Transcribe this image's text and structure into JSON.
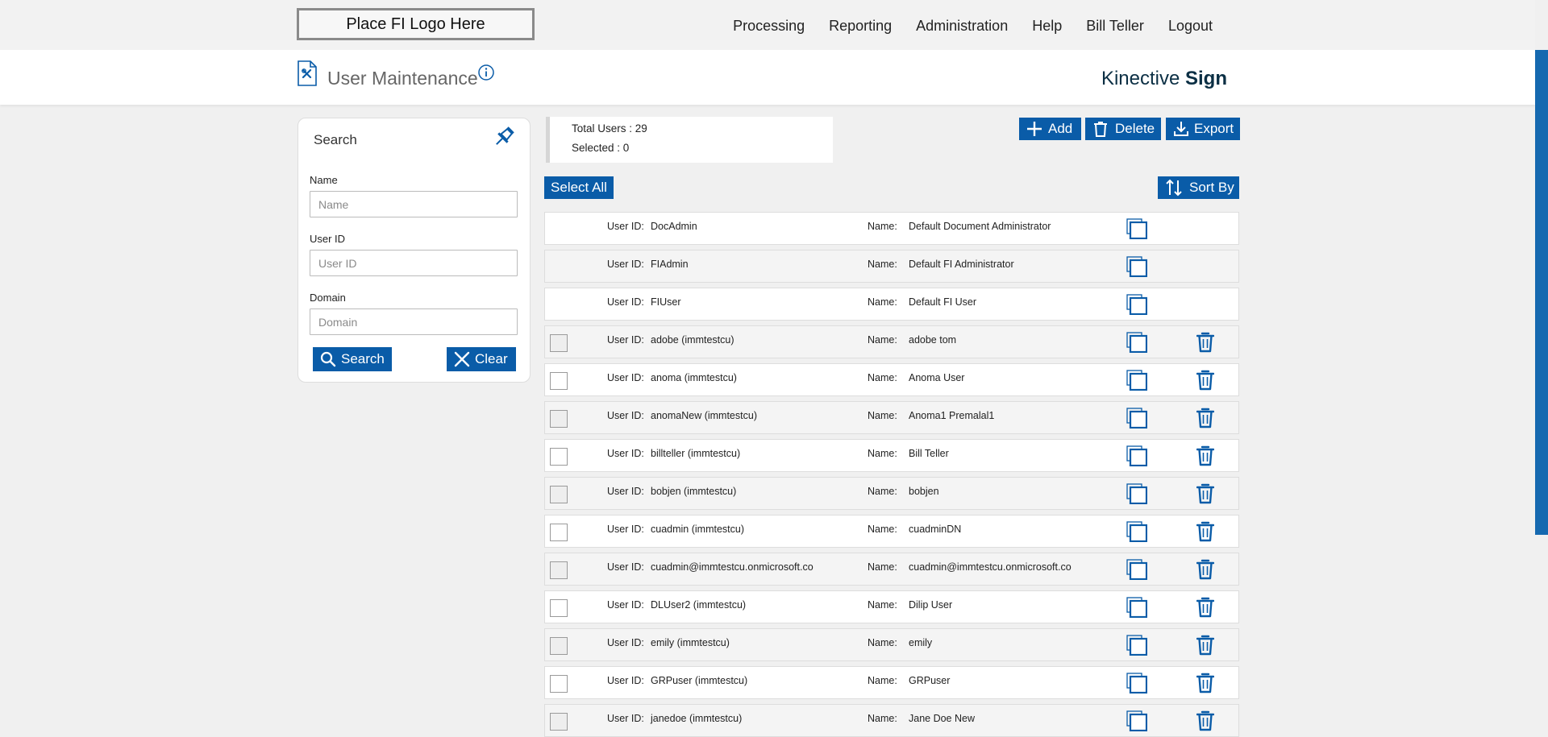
{
  "logo": {
    "text": "Place FI Logo Here"
  },
  "nav": [
    {
      "label": "Processing"
    },
    {
      "label": "Reporting"
    },
    {
      "label": "Administration"
    },
    {
      "label": "Help"
    },
    {
      "label": "Bill Teller"
    },
    {
      "label": "Logout"
    }
  ],
  "header": {
    "title": "User Maintenance",
    "brand_light": "Kinective",
    "brand_bold": "Sign",
    "icons": {
      "page": "document-settings-icon",
      "info": "info-icon"
    }
  },
  "search": {
    "title": "Search",
    "pin_icon": "pin-icon",
    "fields": [
      {
        "label": "Name",
        "placeholder": "Name",
        "value": ""
      },
      {
        "label": "User ID",
        "placeholder": "User ID",
        "value": ""
      },
      {
        "label": "Domain",
        "placeholder": "Domain",
        "value": ""
      }
    ],
    "search_label": "Search",
    "clear_label": "Clear"
  },
  "summary": {
    "total": "Total Users : 29",
    "selected": "Selected : 0"
  },
  "toolbar": {
    "add_label": "Add",
    "delete_label": "Delete",
    "export_label": "Export",
    "select_all_label": "Select All",
    "sort_label": "Sort By"
  },
  "labels": {
    "user_id": "User ID:",
    "name": "Name:"
  },
  "users": [
    {
      "id": "DocAdmin",
      "name": "Default Document Administrator",
      "system": true
    },
    {
      "id": "FIAdmin",
      "name": "Default FI Administrator",
      "system": true
    },
    {
      "id": "FIUser",
      "name": "Default FI User",
      "system": true
    },
    {
      "id": "adobe (immtestcu)",
      "name": "adobe tom",
      "system": false
    },
    {
      "id": "anoma (immtestcu)",
      "name": "Anoma User",
      "system": false
    },
    {
      "id": "anomaNew (immtestcu)",
      "name": "Anoma1 Premalal1",
      "system": false
    },
    {
      "id": "billteller (immtestcu)",
      "name": "Bill Teller",
      "system": false
    },
    {
      "id": "bobjen (immtestcu)",
      "name": "bobjen",
      "system": false
    },
    {
      "id": "cuadmin (immtestcu)",
      "name": "cuadminDN",
      "system": false
    },
    {
      "id": "cuadmin@immtestcu.onmicrosoft.co",
      "name": "cuadmin@immtestcu.onmicrosoft.co",
      "system": false
    },
    {
      "id": "DLUser2 (immtestcu)",
      "name": "Dilip User",
      "system": false
    },
    {
      "id": "emily (immtestcu)",
      "name": "emily",
      "system": false
    },
    {
      "id": "GRPuser (immtestcu)",
      "name": "GRPuser",
      "system": false
    },
    {
      "id": "janedoe (immtestcu)",
      "name": "Jane Doe New",
      "system": false
    }
  ],
  "colors": {
    "accent": "#0a5ca8",
    "scrollbar": "#1569b0",
    "brand": "#0b2f44"
  }
}
